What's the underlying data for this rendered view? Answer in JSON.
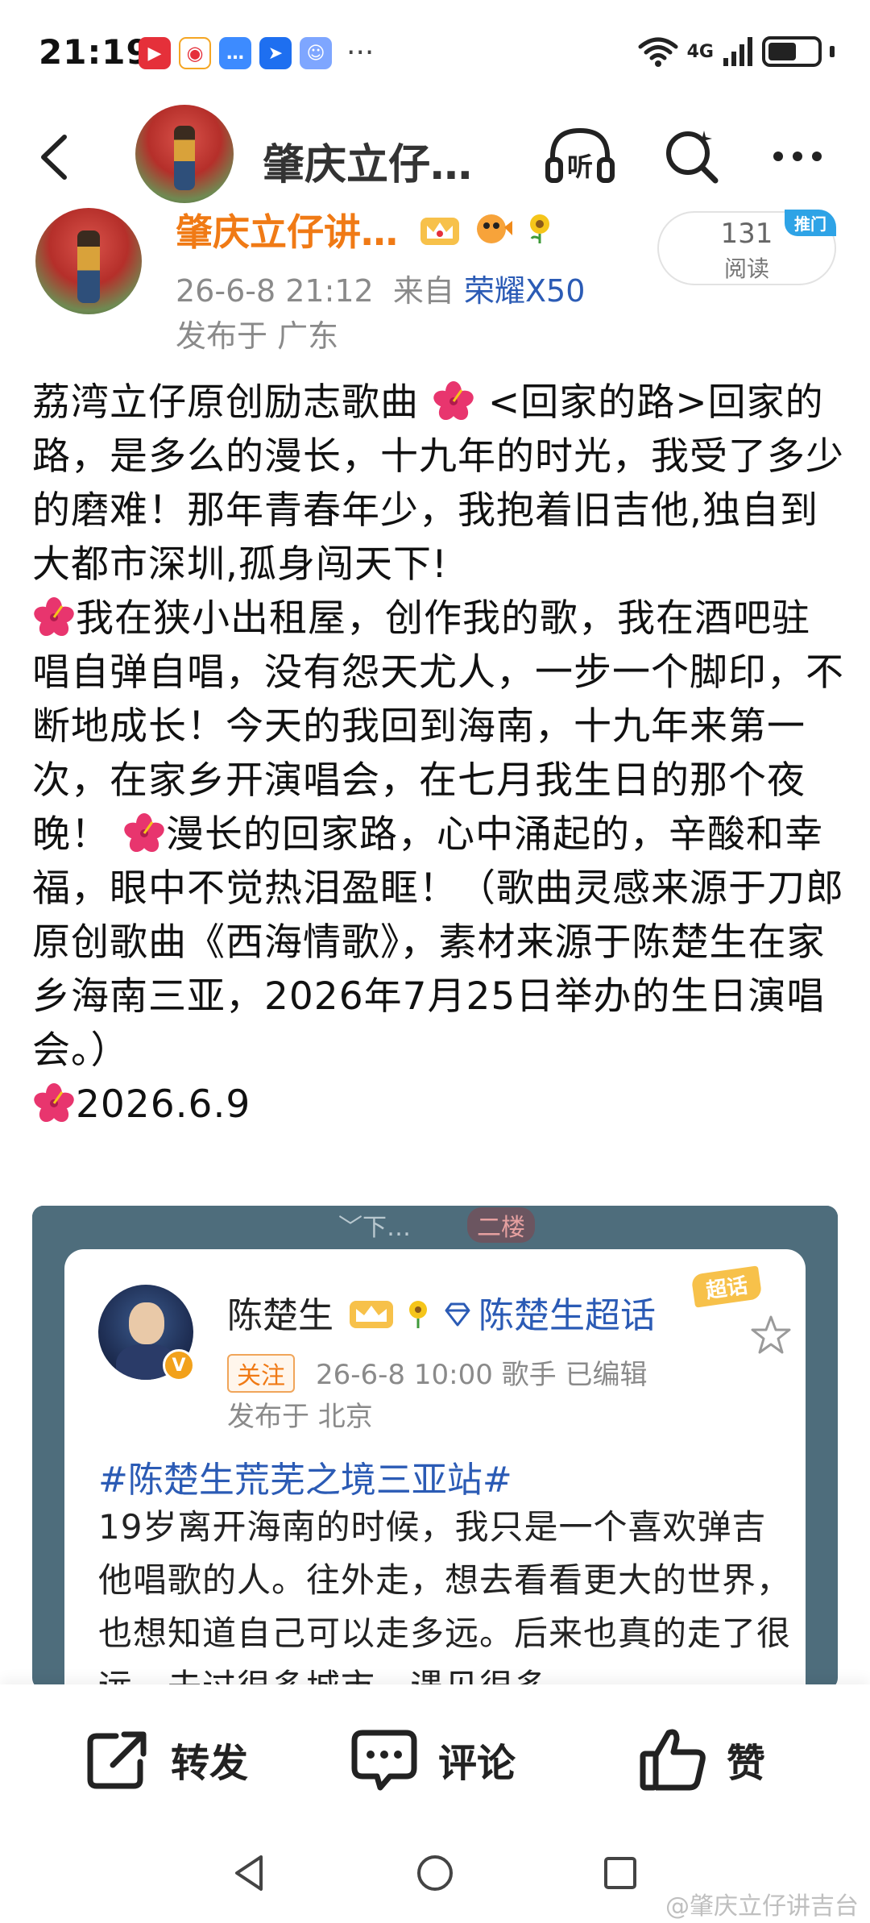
{
  "status_bar": {
    "time": "21:19",
    "network": "4G",
    "more": "···"
  },
  "header": {
    "title": "肇庆立仔…",
    "listen_label": "听"
  },
  "post": {
    "author_name": "肇庆立仔讲…",
    "meta_date": "26-6-8 21:12",
    "meta_from": "来自",
    "meta_device": "荣耀X50",
    "location": "发布于 广东",
    "reads_count": "131",
    "reads_label": "阅读",
    "push_tag": "推门",
    "body": {
      "p1": "荔湾立仔原创励志歌曲 ",
      "p2": " <回家的路>回家的路，是多么的漫长，十九年的时光，我受了多少的磨难！那年青春年少，我抱着旧吉他,独自到大都市深圳,孤身闯天下!",
      "p3": "我在狭小出租屋，创作我的歌，我在酒吧驻唱自弹自唱，没有怨天尤人，一步一个脚印，不断地成长！今天的我回到海南，十九年来第一次，在家乡开演唱会，在七月我生日的那个夜晚！",
      "p4": "漫长的回家路，心中涌起的，辛酸和幸福，眼中不觉热泪盈眶！（歌曲灵感来源于刀郎原创歌曲《西海情歌》，素材来源于陈楚生在家乡海南三亚，2026年7月25日举办的生日演唱会。）",
      "p5": "2026.6.9"
    }
  },
  "embed": {
    "faint_left": "﹀下…",
    "faint_mid": "二楼",
    "author_name": "陈楚生",
    "topic": "陈楚生超话",
    "hot_tag": "超话",
    "follow_label": "关注",
    "meta": "26-6-8 10:00  歌手  已编辑",
    "location": "发布于 北京",
    "v_badge": "V",
    "hashtag": "#陈楚生荒芜之境三亚站#",
    "text": "19岁离开海南的时候，我只是一个喜欢弹吉他唱歌的人。往外走，想去看看更大的世界，也想知道自己可以走多远。后来也真的走了很远…去过很多城市，遇见很多"
  },
  "actions": {
    "repost": "转发",
    "comment": "评论",
    "like": "赞"
  },
  "watermark": "@肇庆立仔讲吉台",
  "colors": {
    "author_orange": "#f07a15",
    "link_blue": "#2b5bb5",
    "meta_gray": "#8a8a8a"
  }
}
